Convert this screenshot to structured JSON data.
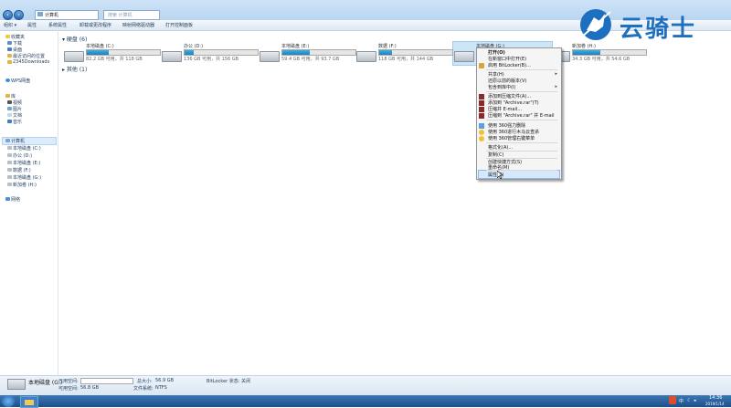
{
  "window": {
    "address": "计算机",
    "search_placeholder": "搜索 计算机"
  },
  "toolbar": [
    "组织 ▾",
    "属性",
    "系统属性",
    "卸载或更改程序",
    "映射网络驱动器",
    "打开控制面板"
  ],
  "sidebar": {
    "favorites_header": "收藏夹",
    "favorites": [
      "下载",
      "桌面",
      "最近访问的位置",
      "2345Downloads"
    ],
    "wps": "WPS网盘",
    "library_header": "库",
    "libraries": [
      "视频",
      "图片",
      "文档",
      "音乐"
    ],
    "computer_header": "计算机",
    "drives": [
      "本地磁盘 (C:)",
      "办公 (D:)",
      "本地磁盘 (E:)",
      "数据 (F:)",
      "本地磁盘 (G:)",
      "新加卷 (H:)"
    ],
    "network": "网络"
  },
  "groups": {
    "hard_disks": "硬盘 (6)",
    "other": "其他 (1)"
  },
  "drives": [
    {
      "name": "本地磁盘 (C:)",
      "free": "82.2 GB 可用，共 118 GB",
      "used_fraction": 0.3
    },
    {
      "name": "办公 (D:)",
      "free": "136 GB 可用，共 156 GB",
      "used_fraction": 0.13
    },
    {
      "name": "本地磁盘 (E:)",
      "free": "59.4 GB 可用，共 93.7 GB",
      "used_fraction": 0.37
    },
    {
      "name": "数据 (F:)",
      "free": "118 GB 可用，共 144 GB",
      "used_fraction": 0.18
    },
    {
      "name": "本地磁盘 (G:)",
      "free": "",
      "used_fraction": 0
    },
    {
      "name": "新加卷 (H:)",
      "free": "34.3 GB 可用，共 54.6 GB",
      "used_fraction": 0.37
    }
  ],
  "context_menu": {
    "items": [
      "打开(O)",
      "在新窗口中打开(E)",
      "启用 BitLocker(B)...",
      "共享(H)",
      "还原以前的版本(V)",
      "包含到库中(I)",
      "添加到压缩文件(A)...",
      "添加到 \"Archive.rar\"(T)",
      "压缩并 E-mail...",
      "压缩到 \"Archive.rar\" 并 E-mail",
      "使用 360强力删除",
      "使用 360进行木马云查杀",
      "使用 360管理右键菜单",
      "格式化(A)...",
      "复制(C)",
      "创建快捷方式(S)",
      "重命名(M)",
      "属性(R)"
    ]
  },
  "details": {
    "drive_name": "本地磁盘 (G:)",
    "used_label": "已用空间:",
    "free_label": "可用空间:",
    "free_value": "56.8 GB",
    "total_label": "总大小:",
    "total_value": "56.9 GB",
    "fs_label": "文件系统:",
    "fs_value": "NTFS",
    "bitlocker_label": "BitLocker 状态:",
    "bitlocker_value": "关闭"
  },
  "tray": {
    "ime": "中",
    "time": "14:36",
    "date": "2019/1/14"
  },
  "watermark": {
    "text": "云骑士",
    "color": "#1e6fc0"
  }
}
